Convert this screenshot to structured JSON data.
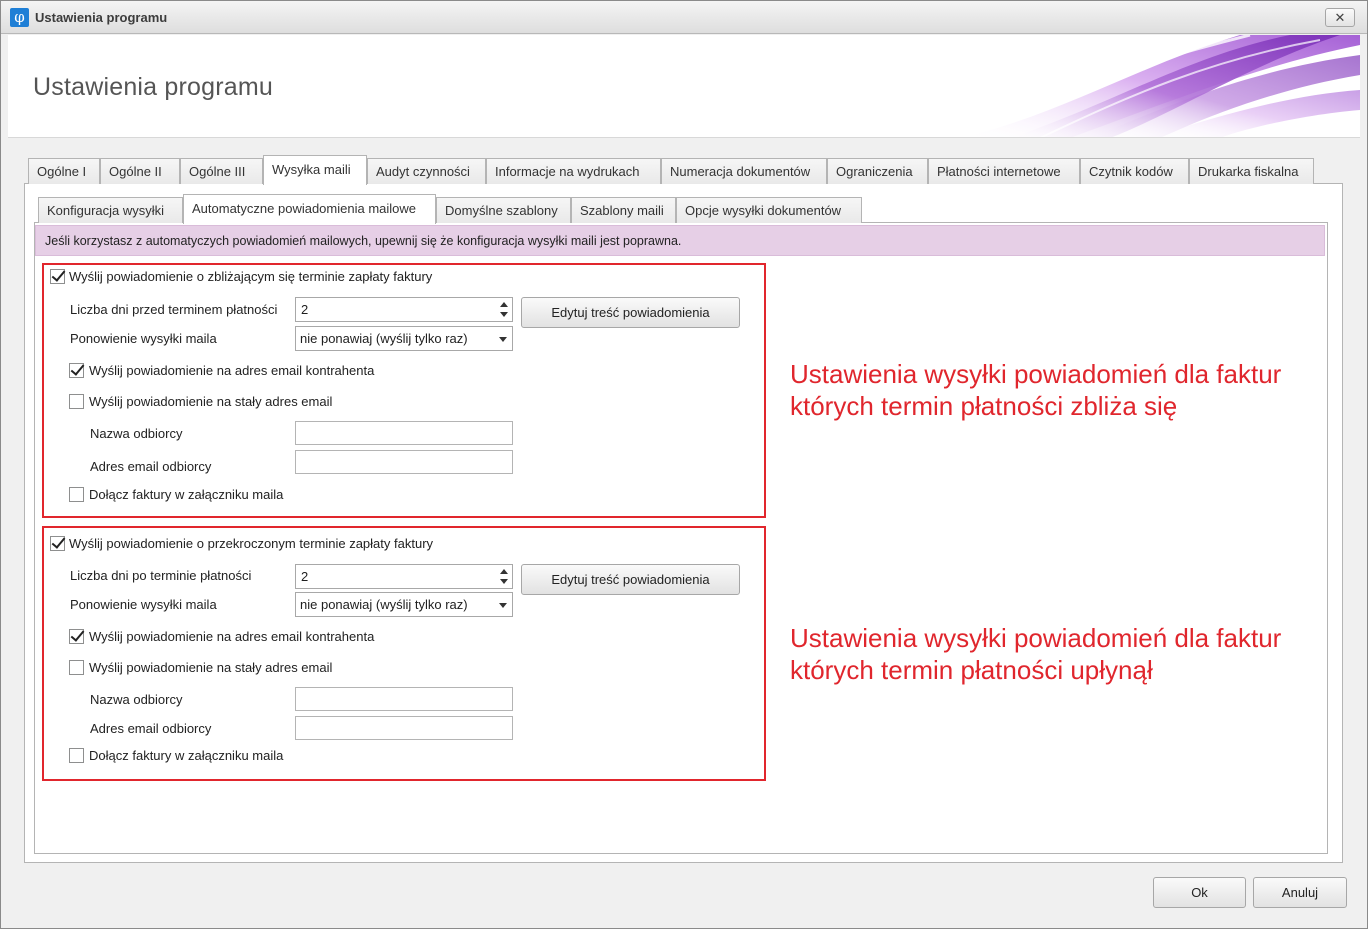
{
  "window": {
    "title": "Ustawienia programu",
    "header_title": "Ustawienia programu",
    "close_label": "✕"
  },
  "main_tabs": [
    {
      "label": "Ogólne I"
    },
    {
      "label": "Ogólne II"
    },
    {
      "label": "Ogólne III"
    },
    {
      "label": "Wysyłka maili",
      "active": true
    },
    {
      "label": "Audyt czynności"
    },
    {
      "label": "Informacje na wydrukach"
    },
    {
      "label": "Numeracja dokumentów"
    },
    {
      "label": "Ograniczenia"
    },
    {
      "label": "Płatności internetowe"
    },
    {
      "label": "Czytnik kodów"
    },
    {
      "label": "Drukarka fiskalna"
    }
  ],
  "sub_tabs": [
    {
      "label": "Konfiguracja wysyłki"
    },
    {
      "label": "Automatyczne powiadomienia mailowe",
      "active": true
    },
    {
      "label": "Domyślne szablony"
    },
    {
      "label": "Szablony maili"
    },
    {
      "label": "Opcje wysyłki dokumentów"
    }
  ],
  "info_text": "Jeśli korzystasz z automatyczych powiadomień mailowych, upewnij się że konfiguracja wysyłki maili jest poprawna.",
  "upcoming": {
    "enable_label": "Wyślij powiadomienie o zbliżającym się terminie zapłaty faktury",
    "enable_checked": true,
    "days_label": "Liczba dni przed terminem płatności",
    "days_value": "2",
    "edit_button": "Edytuj treść powiadomienia",
    "repeat_label": "Ponowienie wysyłki maila",
    "repeat_value": "nie ponawiaj (wyślij tylko raz)",
    "to_client_label": "Wyślij powiadomienie na adres email kontrahenta",
    "to_client_checked": true,
    "to_fixed_label": "Wyślij powiadomienie na stały adres email",
    "to_fixed_checked": false,
    "recipient_name_label": "Nazwa odbiorcy",
    "recipient_name_value": "",
    "recipient_email_label": "Adres email odbiorcy",
    "recipient_email_value": "",
    "attach_label": "Dołącz faktury w załączniku maila",
    "attach_checked": false
  },
  "overdue": {
    "enable_label": "Wyślij powiadomienie o przekroczonym terminie zapłaty faktury",
    "enable_checked": true,
    "days_label": "Liczba dni po terminie płatności",
    "days_value": "2",
    "edit_button": "Edytuj treść powiadomienia",
    "repeat_label": "Ponowienie wysyłki maila",
    "repeat_value": "nie ponawiaj (wyślij tylko raz)",
    "to_client_label": "Wyślij powiadomienie na adres email kontrahenta",
    "to_client_checked": true,
    "to_fixed_label": "Wyślij powiadomienie na stały adres email",
    "to_fixed_checked": false,
    "recipient_name_label": "Nazwa odbiorcy",
    "recipient_name_value": "",
    "recipient_email_label": "Adres email odbiorcy",
    "recipient_email_value": "",
    "attach_label": "Dołącz faktury w załączniku maila",
    "attach_checked": false
  },
  "annotations": {
    "upcoming_line1": "Ustawienia wysyłki powiadomień dla faktur",
    "upcoming_line2": "których termin płatności zbliża się",
    "overdue_line1": "Ustawienia wysyłki powiadomień dla faktur",
    "overdue_line2": "których termin płatności upłynął",
    "color": "#e0262d"
  },
  "footer": {
    "ok_label": "Ok",
    "cancel_label": "Anuluj"
  }
}
